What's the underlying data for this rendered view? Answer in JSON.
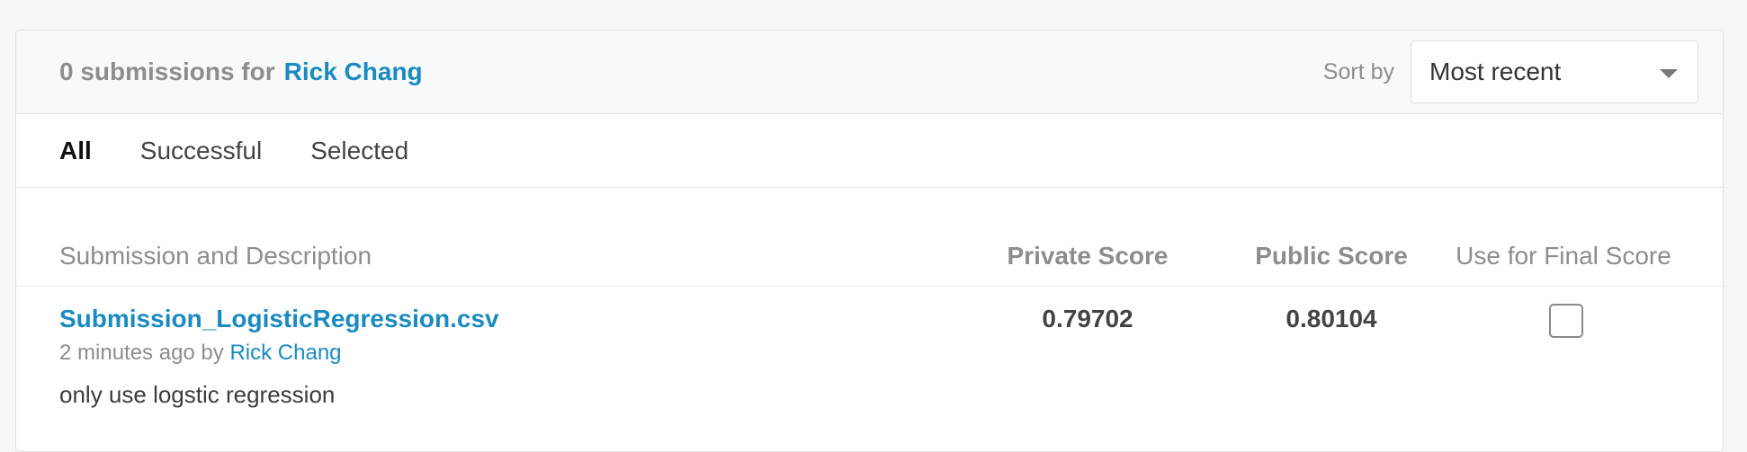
{
  "header": {
    "count_text": "0 submissions for",
    "user_name": "Rick Chang",
    "sort_label": "Sort by",
    "sort_selected": "Most recent"
  },
  "tabs": [
    {
      "label": "All",
      "active": true
    },
    {
      "label": "Successful",
      "active": false
    },
    {
      "label": "Selected",
      "active": false
    }
  ],
  "table": {
    "columns": {
      "description": "Submission and Description",
      "private_score": "Private Score",
      "public_score": "Public Score",
      "final_score": "Use for Final Score"
    },
    "rows": [
      {
        "file_name": "Submission_LogisticRegression.csv",
        "time_text": "2 minutes ago by",
        "user_name": "Rick Chang",
        "description": "only use logstic regression",
        "private_score": "0.79702",
        "public_score": "0.80104",
        "use_for_final": false
      }
    ]
  },
  "icons": {
    "sort_caret": "chevron-down-icon",
    "final_checkbox": "checkbox-unchecked-icon"
  }
}
